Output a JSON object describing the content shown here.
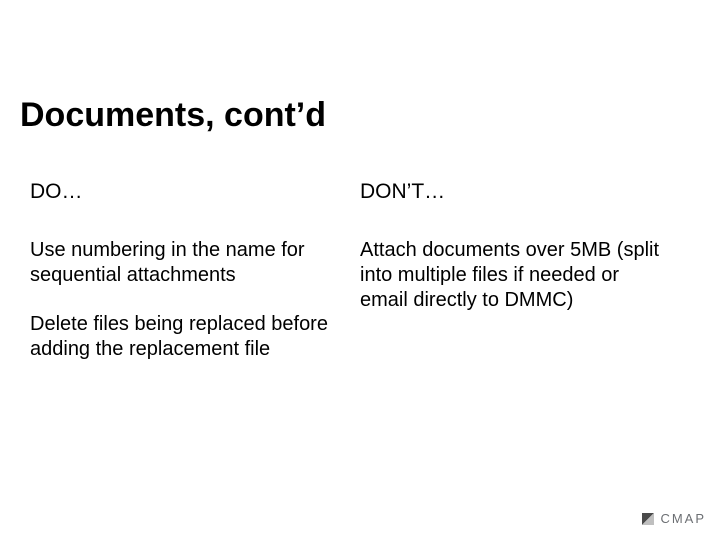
{
  "title": "Documents, cont’d",
  "columns": {
    "do": {
      "header": "DO…",
      "items": [
        "Use numbering in the name for sequential attachments",
        "Delete files being replaced before adding the replacement file"
      ]
    },
    "dont": {
      "header": "DON’T…",
      "items": [
        "Attach documents over 5MB (split into multiple files if needed or email directly to DMMC)"
      ]
    }
  },
  "footer": {
    "logo_text": "CMAP"
  }
}
